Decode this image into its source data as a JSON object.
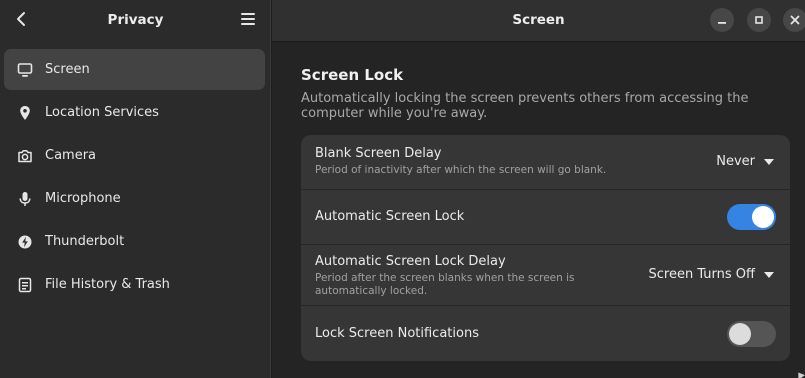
{
  "sidebar": {
    "title": "Privacy",
    "items": [
      {
        "label": "Screen",
        "icon": "monitor-icon"
      },
      {
        "label": "Location Services",
        "icon": "location-pin-icon"
      },
      {
        "label": "Camera",
        "icon": "camera-icon"
      },
      {
        "label": "Microphone",
        "icon": "microphone-icon"
      },
      {
        "label": "Thunderbolt",
        "icon": "thunderbolt-icon"
      },
      {
        "label": "File History & Trash",
        "icon": "file-history-icon"
      }
    ]
  },
  "main": {
    "title": "Screen",
    "section_title": "Screen Lock",
    "section_description": "Automatically locking the screen prevents others from accessing the computer while you're away.",
    "rows": [
      {
        "title": "Blank Screen Delay",
        "subtitle": "Period of inactivity after which the screen will go blank.",
        "value": "Never"
      },
      {
        "title": "Automatic Screen Lock",
        "toggle": true
      },
      {
        "title": "Automatic Screen Lock Delay",
        "subtitle": "Period after the screen blanks when the screen is automatically locked.",
        "value": "Screen Turns Off"
      },
      {
        "title": "Lock Screen Notifications",
        "toggle": false
      }
    ]
  },
  "colors": {
    "accent": "#3584e4",
    "sidebar_bg": "#2b2b2b",
    "content_bg": "#242424",
    "card_bg": "#363636"
  }
}
